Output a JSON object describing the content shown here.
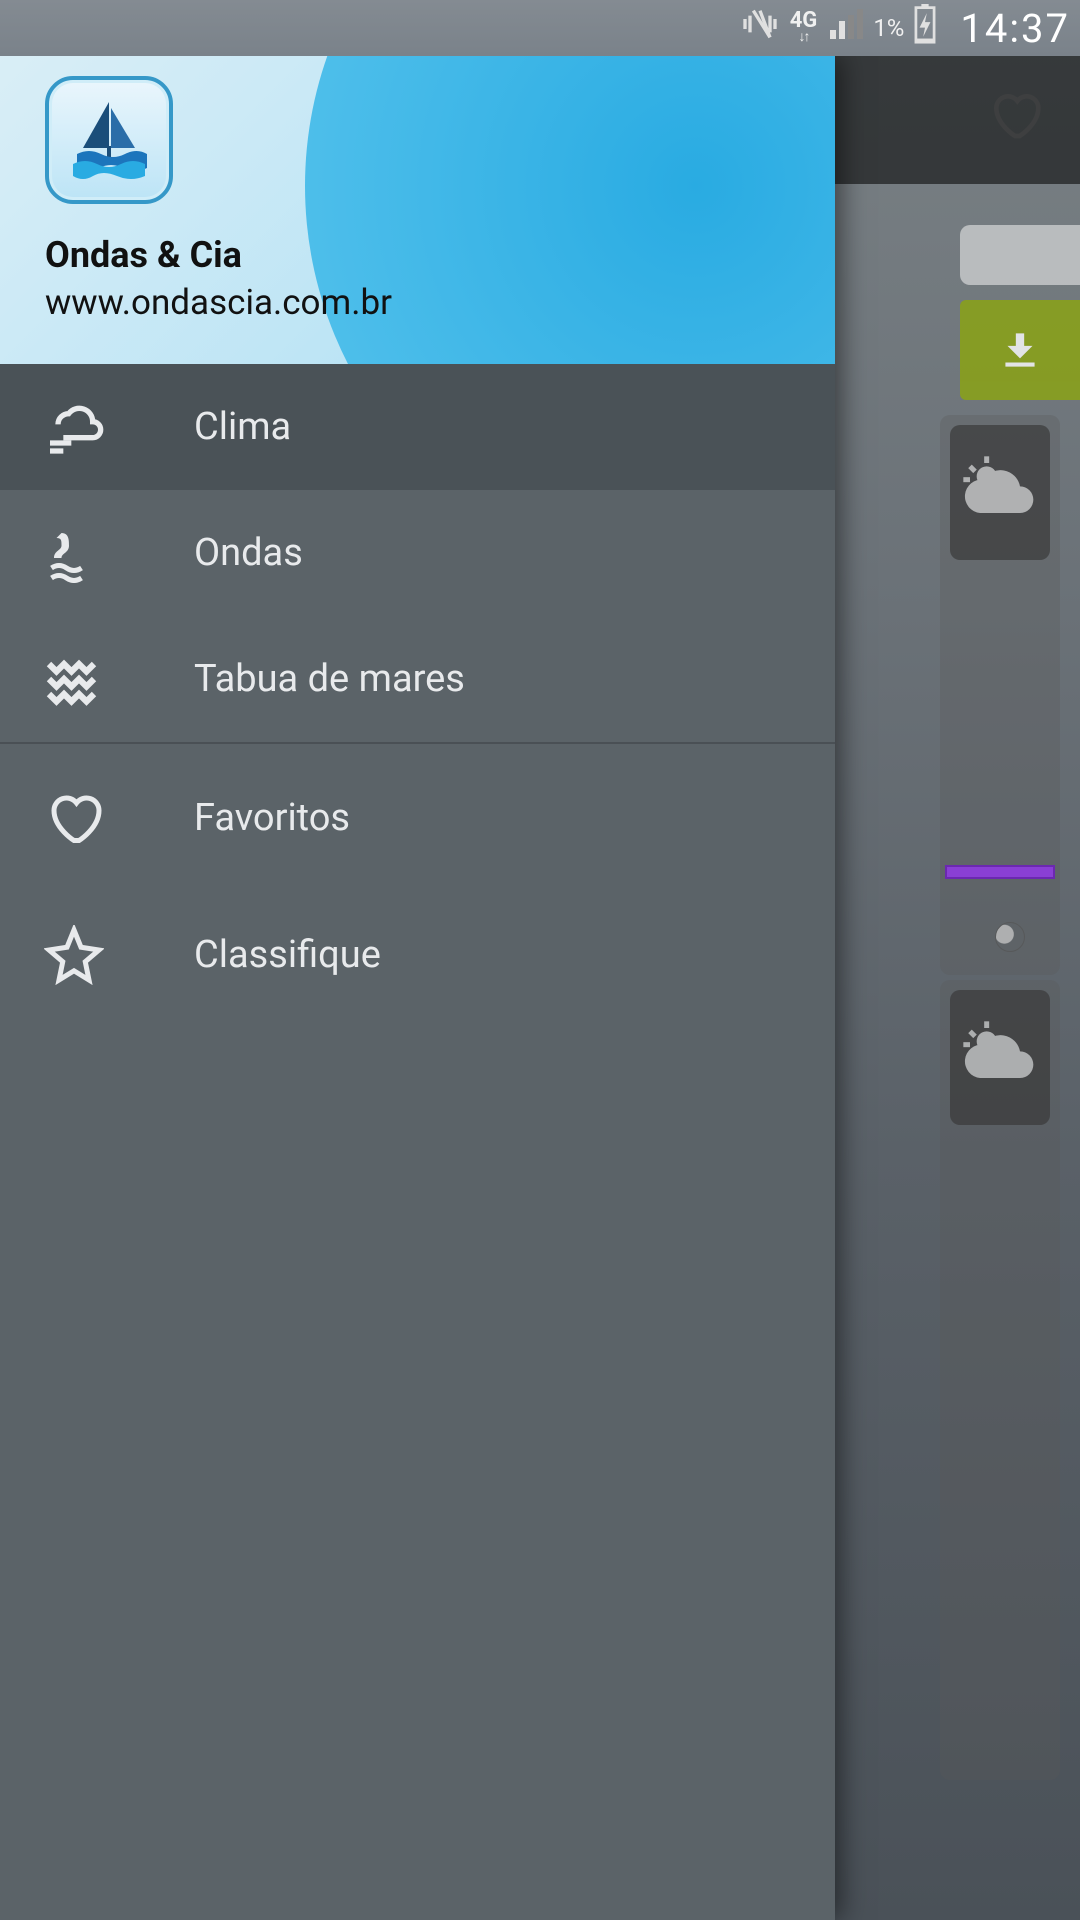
{
  "status": {
    "network": "4G",
    "battery_pct": "1%",
    "clock": "14:37"
  },
  "header": {
    "app_name": "Ondas & Cia",
    "app_url": "www.ondascia.com.br"
  },
  "menu": {
    "items": [
      {
        "label": "Clima"
      },
      {
        "label": "Ondas"
      },
      {
        "label": "Tabua de mares"
      },
      {
        "label": "Favoritos"
      },
      {
        "label": "Classifique"
      }
    ]
  }
}
